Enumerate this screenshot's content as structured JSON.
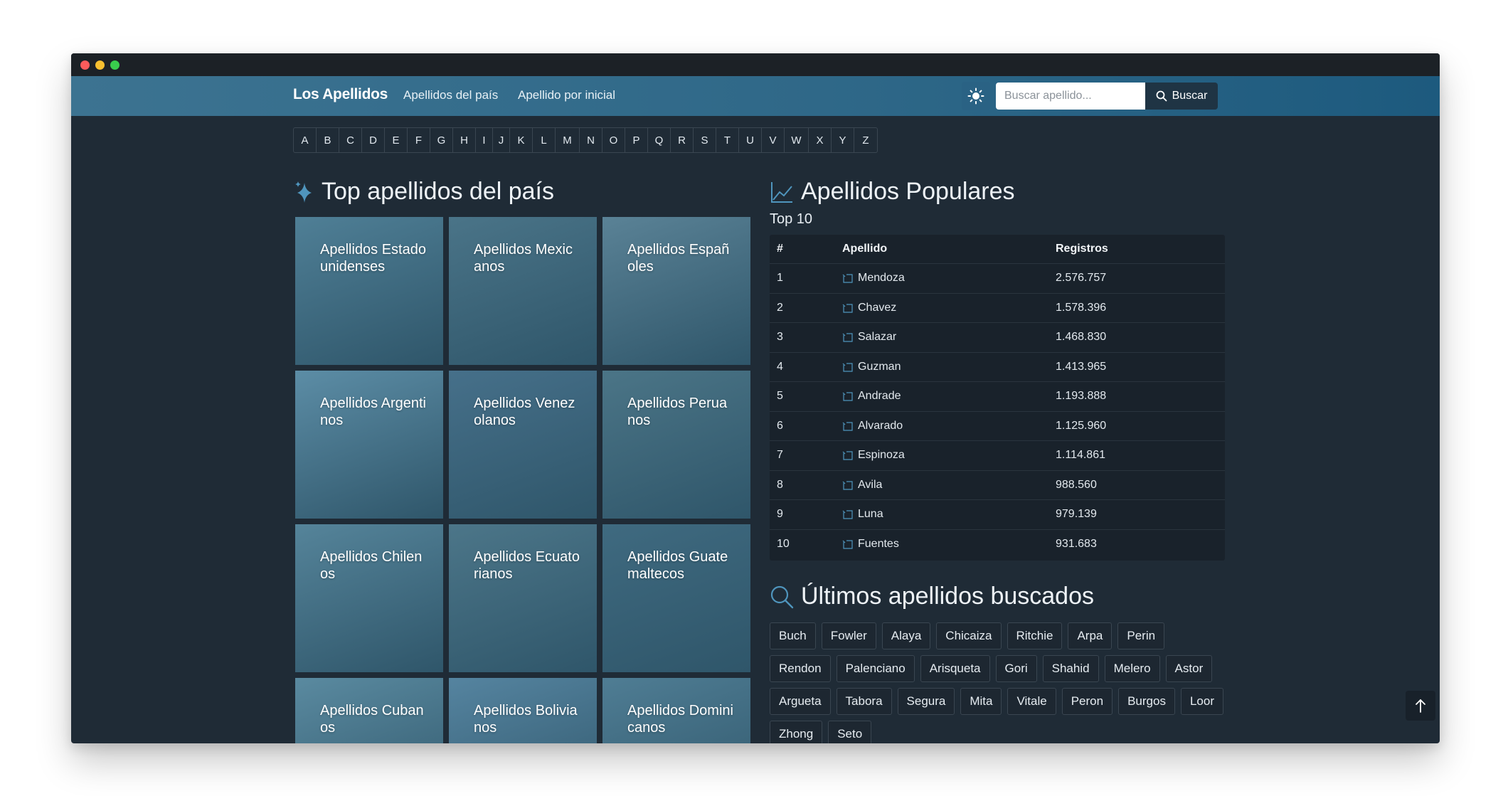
{
  "navbar": {
    "brand": "Los Apellidos",
    "links": [
      "Apellidos del país",
      "Apellido por inicial"
    ],
    "search_placeholder": "Buscar apellido...",
    "search_button": "Buscar",
    "theme_icon": "sun-icon"
  },
  "alphabet": [
    "A",
    "B",
    "C",
    "D",
    "E",
    "F",
    "G",
    "H",
    "I",
    "J",
    "K",
    "L",
    "M",
    "N",
    "O",
    "P",
    "Q",
    "R",
    "S",
    "T",
    "U",
    "V",
    "W",
    "X",
    "Y",
    "Z"
  ],
  "countries_section": {
    "title": "Top apellidos del país",
    "icon": "sparkle-icon",
    "tiles": [
      {
        "label": "Apellidos Estadounidenses",
        "color": "#4f7f96"
      },
      {
        "label": "Apellidos Mexicanos",
        "color": "#4a7488"
      },
      {
        "label": "Apellidos Españoles",
        "color": "#5a8296"
      },
      {
        "label": "Apellidos Argentinos",
        "color": "#5c8da6"
      },
      {
        "label": "Apellidos Venezolanos",
        "color": "#46708a"
      },
      {
        "label": "Apellidos Peruanos",
        "color": "#4b7587"
      },
      {
        "label": "Apellidos Chilenos",
        "color": "#55849a"
      },
      {
        "label": "Apellidos Ecuatorianos",
        "color": "#4c7689"
      },
      {
        "label": "Apellidos Guatemaltecos",
        "color": "#3f6a80"
      },
      {
        "label": "Apellidos Cubanos",
        "color": "#5a8aa0"
      },
      {
        "label": "Apellidos Bolivianos",
        "color": "#5584a0"
      },
      {
        "label": "Apellidos Dominicanos",
        "color": "#4f7d94"
      }
    ]
  },
  "popular": {
    "title": "Apellidos Populares",
    "icon": "trend-chart-icon",
    "subtitle": "Top 10",
    "headers": {
      "rank": "#",
      "name": "Apellido",
      "count": "Registros"
    },
    "rows": [
      {
        "rank": "1",
        "name": "Mendoza",
        "count": "2.576.757"
      },
      {
        "rank": "2",
        "name": "Chavez",
        "count": "1.578.396"
      },
      {
        "rank": "3",
        "name": "Salazar",
        "count": "1.468.830"
      },
      {
        "rank": "4",
        "name": "Guzman",
        "count": "1.413.965"
      },
      {
        "rank": "5",
        "name": "Andrade",
        "count": "1.193.888"
      },
      {
        "rank": "6",
        "name": "Alvarado",
        "count": "1.125.960"
      },
      {
        "rank": "7",
        "name": "Espinoza",
        "count": "1.114.861"
      },
      {
        "rank": "8",
        "name": "Avila",
        "count": "988.560"
      },
      {
        "rank": "9",
        "name": "Luna",
        "count": "979.139"
      },
      {
        "rank": "10",
        "name": "Fuentes",
        "count": "931.683"
      }
    ]
  },
  "recent": {
    "title": "Últimos apellidos buscados",
    "icon": "search-icon",
    "tags": [
      "Buch",
      "Fowler",
      "Alaya",
      "Chicaiza",
      "Ritchie",
      "Arpa",
      "Perin",
      "Rendon",
      "Palenciano",
      "Arisqueta",
      "Gori",
      "Shahid",
      "Melero",
      "Astor",
      "Argueta",
      "Tabora",
      "Segura",
      "Mita",
      "Vitale",
      "Peron",
      "Burgos",
      "Loor",
      "Zhong",
      "Seto"
    ]
  },
  "colors": {
    "accent": "#3c7391",
    "background": "#1f2b36",
    "table": "#19222b"
  }
}
